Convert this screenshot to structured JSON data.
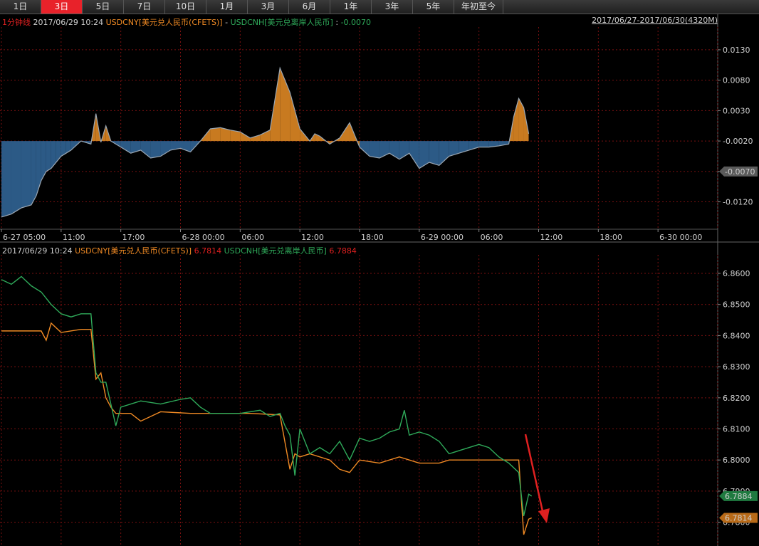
{
  "tabs": [
    {
      "label": "1日",
      "active": false
    },
    {
      "label": "3日",
      "active": true
    },
    {
      "label": "5日",
      "active": false
    },
    {
      "label": "7日",
      "active": false
    },
    {
      "label": "10日",
      "active": false
    },
    {
      "label": "1月",
      "active": false
    },
    {
      "label": "3月",
      "active": false
    },
    {
      "label": "6月",
      "active": false
    },
    {
      "label": "1年",
      "active": false
    },
    {
      "label": "3年",
      "active": false
    },
    {
      "label": "5年",
      "active": false
    },
    {
      "label": "年初至今",
      "active": false
    }
  ],
  "top_header": {
    "interval": "1分钟线",
    "timestamp": "2017/06/29 10:24",
    "series_a": "USDCNY[美元兑人民币(CFETS)]",
    "op": "-",
    "series_b": "USDCNH[美元兑离岸人民币]",
    "value_sep": ":",
    "value": "-0.0070",
    "range": "2017/06/27-2017/06/30(4320M)"
  },
  "bottom_header": {
    "timestamp": "2017/06/29 10:24",
    "series_a": "USDCNY[美元兑人民币(CFETS)]",
    "series_a_value": "6.7814",
    "series_b": "USDCNH[美元兑离岸人民币]",
    "series_b_value": "6.7884"
  },
  "colors": {
    "cny": "#f08a24",
    "cnh": "#2faa5a",
    "diff_fill_neg": "#2c5a86",
    "diff_fill_pos": "#c87a20",
    "diff_line": "#9aa6b2",
    "grid": "#7a1010",
    "arrow": "#e02020"
  },
  "chart_data": [
    {
      "type": "area",
      "name": "spread",
      "ylim": [
        -0.0165,
        0.0165
      ],
      "yticks": [
        "0.0130",
        "0.0080",
        "0.0030",
        "-0.0020",
        "-0.0070",
        "-0.0120"
      ],
      "ytick_values": [
        0.013,
        0.008,
        0.003,
        -0.002,
        -0.007,
        -0.012
      ],
      "xticks": [
        "6-27 05:00",
        "11:00",
        "17:00",
        "6-28 00:00",
        "06:00",
        "12:00",
        "18:00",
        "6-29 00:00",
        "06:00",
        "12:00",
        "18:00",
        "6-30 00:00"
      ],
      "x_range_hours": [
        0,
        72
      ],
      "current_label": "-0.0070",
      "current_value": -0.007,
      "x": [
        0,
        1,
        2,
        3,
        3.5,
        4,
        4.5,
        5,
        5.5,
        6,
        6.5,
        7,
        8,
        9,
        9.5,
        10,
        10.5,
        11,
        12,
        13,
        14,
        15,
        16,
        17,
        18,
        19,
        20,
        21,
        22,
        23,
        24,
        25,
        26,
        27,
        28,
        29,
        30,
        31,
        31.5,
        32,
        33,
        34,
        35,
        36,
        37,
        38,
        39,
        40,
        41,
        42,
        43,
        44,
        45,
        46,
        47,
        48,
        49,
        50,
        51,
        51.5,
        52,
        52.5,
        53
      ],
      "y": [
        -0.0145,
        -0.014,
        -0.013,
        -0.0125,
        -0.011,
        -0.0085,
        -0.007,
        -0.0065,
        -0.0055,
        -0.0045,
        -0.004,
        -0.0035,
        -0.002,
        -0.0025,
        0.0025,
        -0.0022,
        0.0005,
        -0.002,
        -0.003,
        -0.004,
        -0.0035,
        -0.0048,
        -0.0045,
        -0.0035,
        -0.0032,
        -0.0038,
        -0.002,
        0.0,
        0.0002,
        -0.0002,
        -0.0005,
        -0.0015,
        -0.001,
        -0.0002,
        0.01,
        0.006,
        0.0,
        -0.002,
        -0.0008,
        -0.0012,
        -0.0025,
        -0.0015,
        0.001,
        -0.003,
        -0.0045,
        -0.0048,
        -0.004,
        -0.005,
        -0.004,
        -0.0065,
        -0.0055,
        -0.006,
        -0.0045,
        -0.004,
        -0.0035,
        -0.003,
        -0.003,
        -0.0028,
        -0.0025,
        0.002,
        0.005,
        0.0035,
        -0.0008
      ]
    },
    {
      "type": "line",
      "ylim": [
        6.7735,
        6.8655
      ],
      "yticks": [
        "6.8600",
        "6.8500",
        "6.8400",
        "6.8300",
        "6.8200",
        "6.8100",
        "6.8000",
        "6.7900",
        "6.7800"
      ],
      "ytick_values": [
        6.86,
        6.85,
        6.84,
        6.83,
        6.82,
        6.81,
        6.8,
        6.79,
        6.78
      ],
      "series": [
        {
          "name": "USDCNY",
          "label": "6.7814",
          "last": 6.7814,
          "x": [
            0,
            4,
            4.5,
            5,
            6,
            8,
            9,
            9.5,
            10,
            10.5,
            11,
            11.5,
            13,
            14,
            16,
            19,
            22,
            25,
            28,
            29,
            29.5,
            30,
            31,
            33,
            34,
            35,
            36,
            38,
            40,
            42,
            44,
            45,
            47,
            49,
            50,
            52,
            52.5,
            53,
            53.3
          ],
          "y": [
            6.8415,
            6.8415,
            6.8385,
            6.844,
            6.841,
            6.842,
            6.842,
            6.826,
            6.828,
            6.82,
            6.817,
            6.815,
            6.815,
            6.8125,
            6.8155,
            6.815,
            6.815,
            6.815,
            6.8145,
            6.797,
            6.802,
            6.801,
            6.802,
            6.8,
            6.797,
            6.796,
            6.8,
            6.799,
            6.801,
            6.799,
            6.799,
            6.8,
            6.8,
            6.8,
            6.8,
            6.8,
            6.776,
            6.781,
            6.7814
          ]
        },
        {
          "name": "USDCNH",
          "label": "6.7884",
          "last": 6.7884,
          "x": [
            0,
            1,
            2,
            3,
            4,
            5,
            6,
            7,
            8,
            9,
            9.5,
            10,
            10.5,
            11,
            11.5,
            12,
            14,
            16,
            18,
            19,
            20,
            21,
            22,
            24,
            26,
            27,
            28,
            28.5,
            29,
            29.5,
            30,
            31,
            32,
            33,
            34,
            35,
            36,
            37,
            38,
            39,
            40,
            40.5,
            41,
            42,
            43,
            44,
            45,
            46,
            47,
            48,
            49,
            50,
            51,
            52,
            52.5,
            53,
            53.3
          ],
          "y": [
            6.858,
            6.8565,
            6.859,
            6.856,
            6.854,
            6.85,
            6.847,
            6.846,
            6.847,
            6.847,
            6.828,
            6.825,
            6.825,
            6.818,
            6.811,
            6.817,
            6.819,
            6.818,
            6.8195,
            6.82,
            6.817,
            6.815,
            6.815,
            6.815,
            6.816,
            6.814,
            6.815,
            6.811,
            6.808,
            6.795,
            6.81,
            6.802,
            6.804,
            6.802,
            6.806,
            6.8,
            6.807,
            6.806,
            6.807,
            6.809,
            6.81,
            6.816,
            6.808,
            6.809,
            6.808,
            6.806,
            6.802,
            6.803,
            6.804,
            6.805,
            6.804,
            6.801,
            6.799,
            6.796,
            6.782,
            6.789,
            6.7884
          ]
        }
      ]
    }
  ]
}
